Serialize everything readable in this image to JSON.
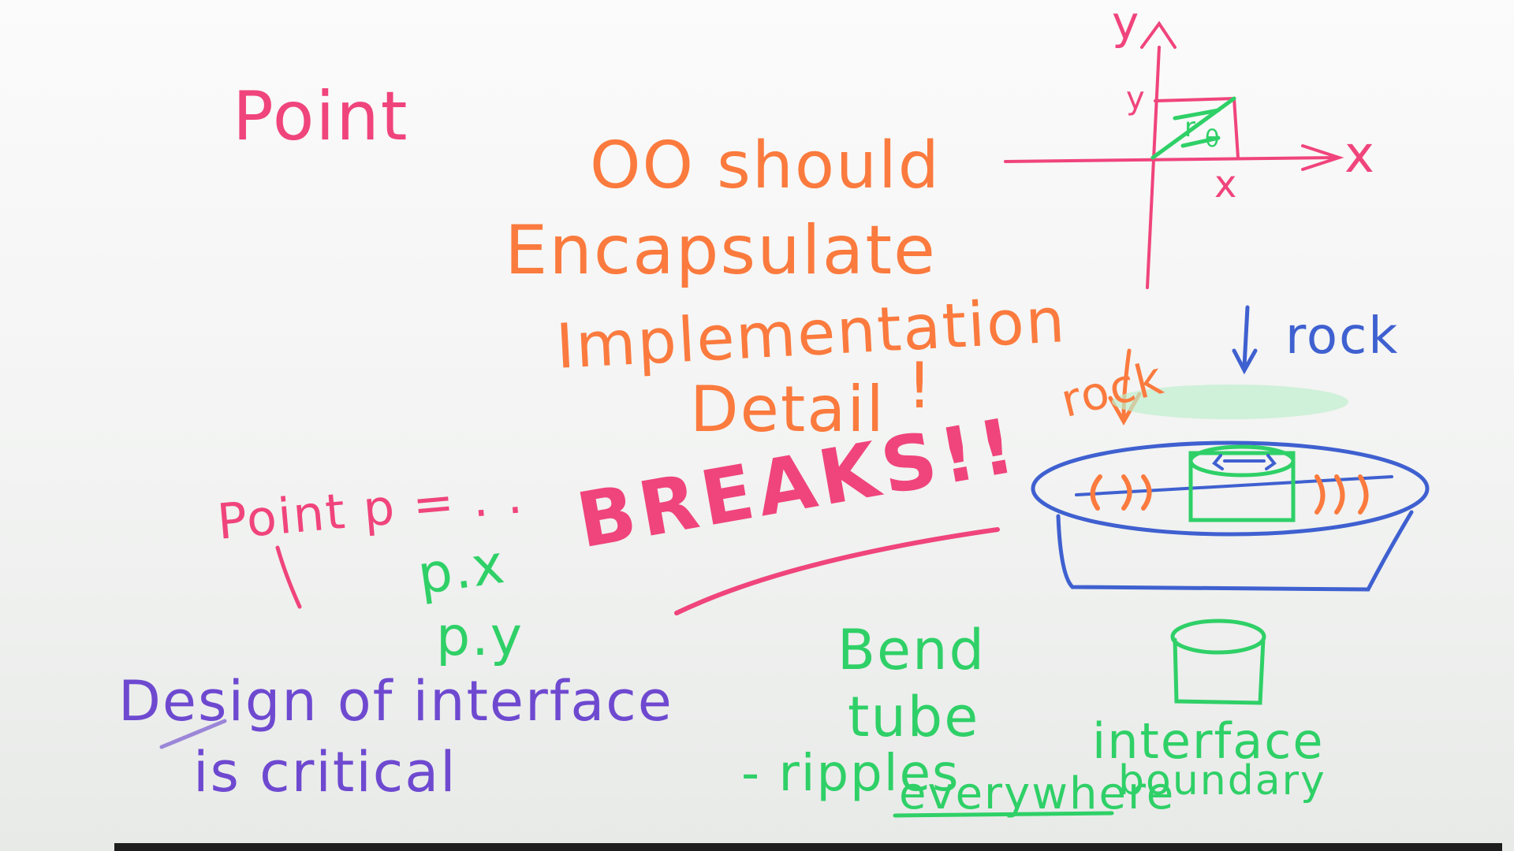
{
  "colors": {
    "pink": "#f0447c",
    "orange": "#fb7a3e",
    "green": "#2fd067",
    "purple": "#6e49d0",
    "blue": "#3f60d0",
    "board": "#f6f6f6"
  },
  "whiteboard": {
    "point_label": "Point",
    "oo_line1": "OO should",
    "oo_line2": "Encapsulate",
    "oo_line3": "Implementation",
    "oo_line4": "Detail",
    "oo_exclaim": "!",
    "point_decl": "Point p = . .",
    "px": "p.x",
    "py": "p.y",
    "breaks": "BREAKS!!",
    "design_line1": "Design of interface",
    "design_line2": "is critical",
    "bend": "Bend",
    "tube": "tube",
    "ripples": "- ripples",
    "everywhere": "everywhere",
    "interface": "interface",
    "boundary": "boundary",
    "rock_left": "rock",
    "rock_right": "rock",
    "axis_y": "y",
    "axis_x": "x",
    "coord_y": "y",
    "coord_x": "x",
    "triangle_r": "r",
    "triangle_theta": "θ"
  }
}
